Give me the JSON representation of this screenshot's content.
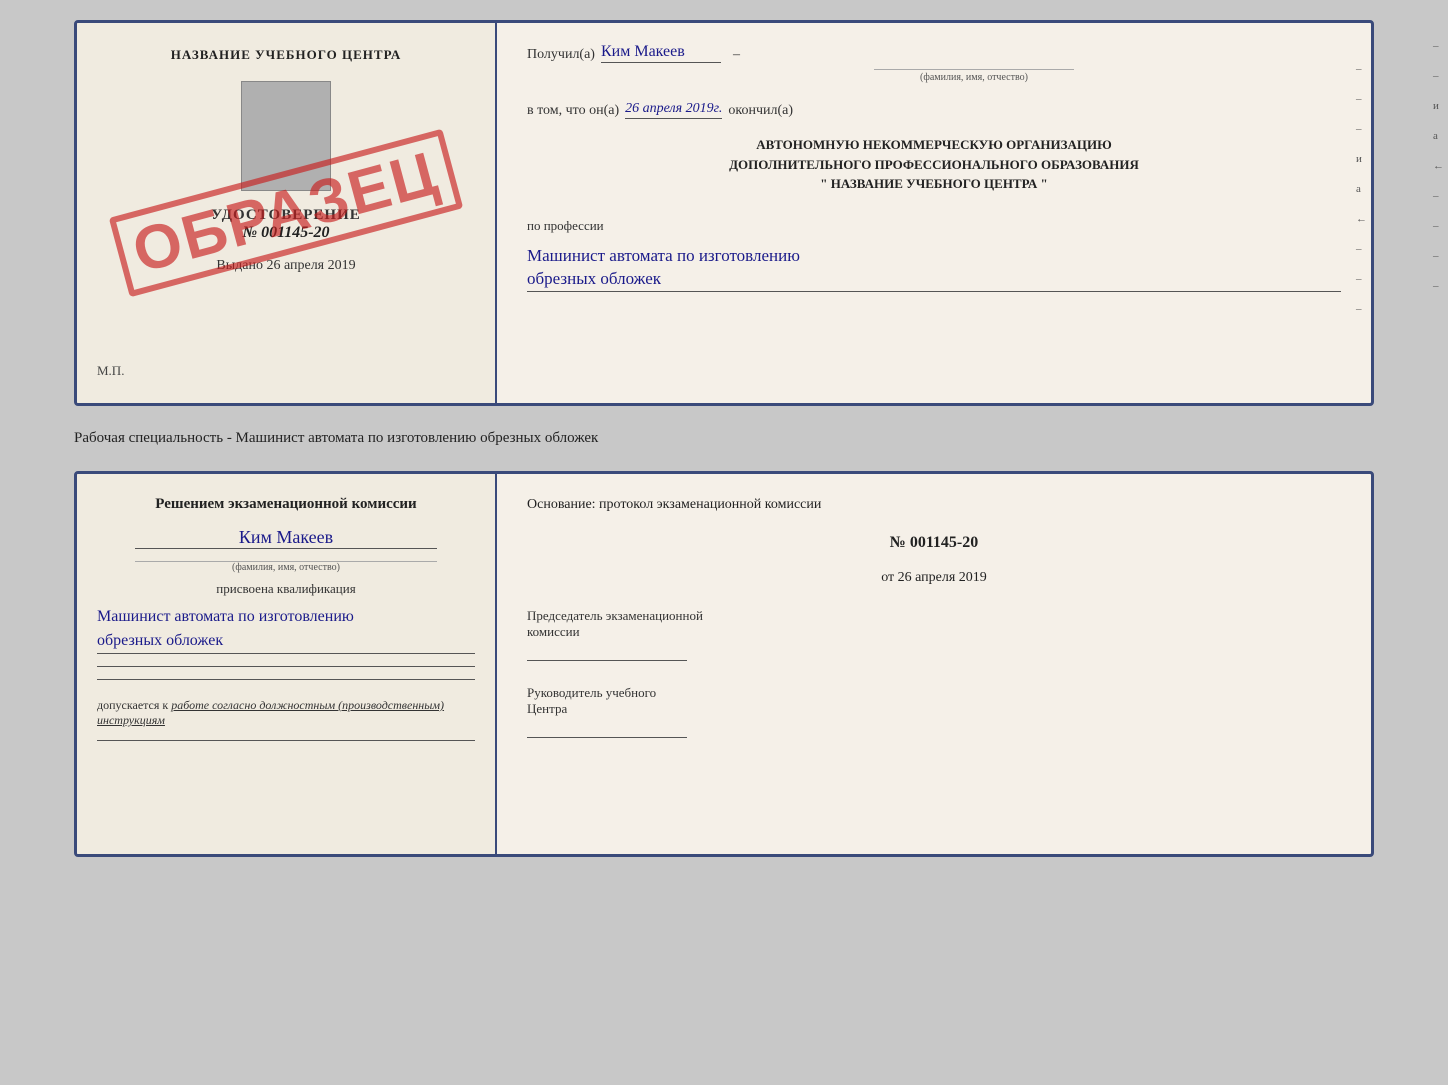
{
  "top_doc": {
    "left": {
      "center_title": "НАЗВАНИЕ УЧЕБНОГО ЦЕНТРА",
      "udostoverenie": "УДОСТОВЕРЕНИЕ",
      "number": "№ 001145-20",
      "vydano_label": "Выдано",
      "vydano_date": "26 апреля 2019",
      "mp": "М.П.",
      "stamp": "ОБРАЗЕЦ"
    },
    "right": {
      "poluchil_label": "Получил(а)",
      "person_name": "Ким Макеев",
      "fio_sub": "(фамилия, имя, отчество)",
      "vtom_label": "в том, что он(а)",
      "date_value": "26 апреля 2019г.",
      "okonchil_label": "окончил(а)",
      "org_line1": "АВТОНОМНУЮ НЕКОММЕРЧЕСКУЮ ОРГАНИЗАЦИЮ",
      "org_line2": "ДОПОЛНИТЕЛЬНОГО ПРОФЕССИОНАЛЬНОГО ОБРАЗОВАНИЯ",
      "org_line3": "\" НАЗВАНИЕ УЧЕБНОГО ЦЕНТРА \"",
      "po_professii": "по профессии",
      "profession1": "Машинист автомата по изготовлению",
      "profession2": "обрезных обложек"
    }
  },
  "middle_text": "Рабочая специальность - Машинист автомата по изготовлению обрезных обложек",
  "bottom_doc": {
    "left": {
      "komissia_title": "Решением экзаменационной комиссии",
      "person_name": "Ким Макеев",
      "fio_sub": "(фамилия, имя, отчество)",
      "prisvoena": "присвоена квалификация",
      "qualification1": "Машинист автомата по изготовлению",
      "qualification2": "обрезных обложек",
      "dopuskaetsya_prefix": "допускается к",
      "dopuskaetsya_text": "работе согласно должностным (производственным) инструкциям"
    },
    "right": {
      "osnovanie_label": "Основание: протокол экзаменационной комиссии",
      "protokol_number": "№ 001145-20",
      "ot_label": "от",
      "ot_date": "26 апреля 2019",
      "chairman_label1": "Председатель экзаменационной",
      "chairman_label2": "комиссии",
      "rukov_label1": "Руководитель учебного",
      "rukov_label2": "Центра"
    }
  },
  "side_marks": [
    "-",
    "-",
    "-",
    "и",
    "а",
    "←",
    "-",
    "-",
    "-",
    "-"
  ]
}
